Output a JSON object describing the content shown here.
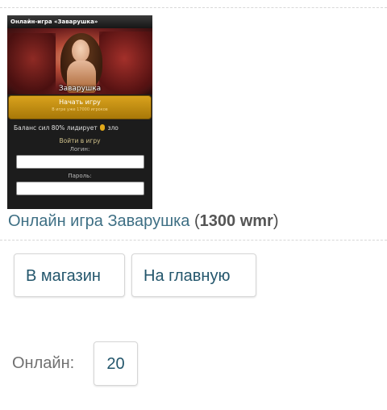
{
  "thumbnail": {
    "header": "Онлайн-игра «Заварушка»",
    "art_title": "Заварушка",
    "start_button": "Начать игру",
    "start_subtext": "В игре уже 17000 игроков",
    "balance_text": "Баланс сил 80% лидирует",
    "balance_side": "зло",
    "login_heading": "Войти в игру",
    "login_label": "Логин:",
    "password_label": "Пароль:"
  },
  "product": {
    "title_link": "Онлайн игра Заварушка",
    "open_paren": " (",
    "price": "1300 wmr",
    "close_paren": ")"
  },
  "buttons": {
    "shop": "В магазин",
    "home": "На главную"
  },
  "online": {
    "label": "Онлайн:",
    "count": "20"
  }
}
